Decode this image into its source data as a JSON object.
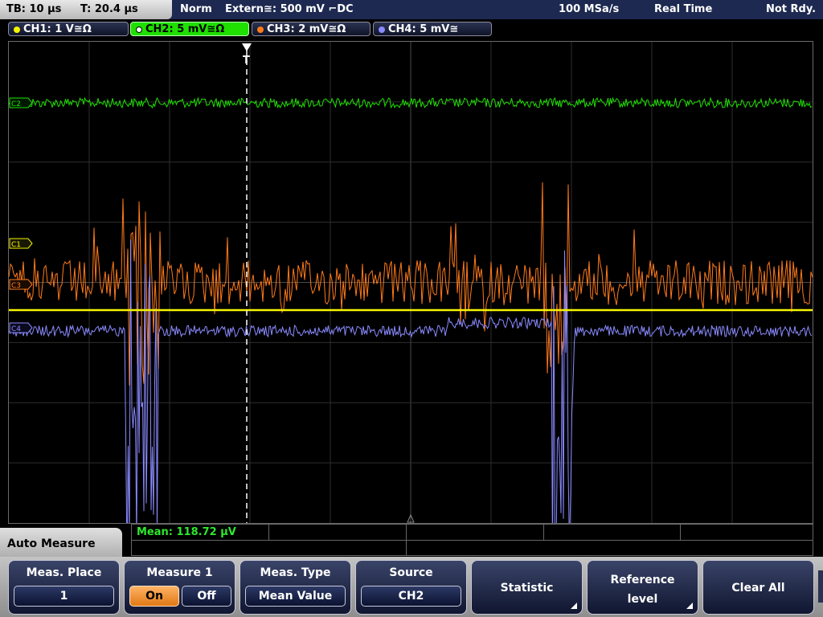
{
  "status": {
    "tb": "TB: 10 µs",
    "trigger_time": "T: 20.4 µs",
    "mode": "Norm",
    "trigger_source": "Extern≅: 500 mV ⌐DC",
    "sample_rate": "100 MSa/s",
    "acq_mode": "Real Time",
    "state": "Not Rdy."
  },
  "channels": [
    {
      "label": "CH1: 1 V≅Ω",
      "color": "#f5f500"
    },
    {
      "label": "CH2: 5 mV≅Ω",
      "color": "#1fe000"
    },
    {
      "label": "CH3: 2 mV≅Ω",
      "color": "#ff7a1a"
    },
    {
      "label": "CH4: 5 mV≅",
      "color": "#8a8aff"
    }
  ],
  "markers": {
    "c1": "C1",
    "c2": "C2",
    "c3": "C3",
    "c4": "C4",
    "trigger": "T"
  },
  "measurement": {
    "mean": "Mean: 118.72 µV"
  },
  "menu": {
    "title": "Auto Measure",
    "softkeys": {
      "meas_place": {
        "label": "Meas. Place",
        "value": "1"
      },
      "measure1": {
        "label": "Measure 1",
        "on": "On",
        "off": "Off"
      },
      "meas_type": {
        "label": "Meas. Type",
        "value": "Mean Value"
      },
      "source": {
        "label": "Source",
        "value": "CH2"
      },
      "statistic": {
        "label": "Statistic"
      },
      "reference": {
        "line1": "Reference",
        "line2": "level"
      },
      "clear_all": {
        "label": "Clear All"
      }
    }
  }
}
